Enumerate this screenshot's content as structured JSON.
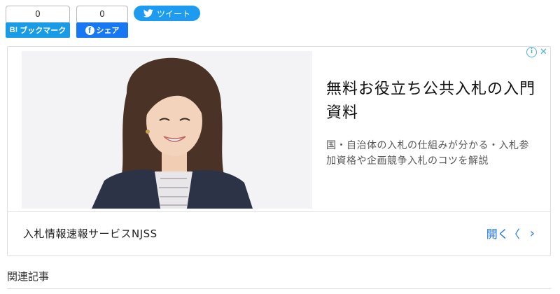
{
  "share": {
    "hatena": {
      "count": "0",
      "logo": "B!",
      "label": "ブックマーク"
    },
    "facebook": {
      "count": "0",
      "label": "シェア"
    },
    "twitter": {
      "label": "ツイート"
    }
  },
  "ad": {
    "title": "無料お役立ち公共入札の入門資料",
    "description": "国・自治体の入札の仕組みが分かる・入札参加資格や企画競争入札のコツを解説",
    "advertiser": "入札情報速報サービスNJSS",
    "open_label": "開く",
    "open_chevron": "〈",
    "arrow": "›",
    "info_icon": "i",
    "close_icon": "✕"
  },
  "related": {
    "heading": "関連記事"
  },
  "colors": {
    "hatena": "#1a9be6",
    "facebook": "#1877f2",
    "twitter": "#1d9bf0",
    "link": "#1a73e8"
  }
}
